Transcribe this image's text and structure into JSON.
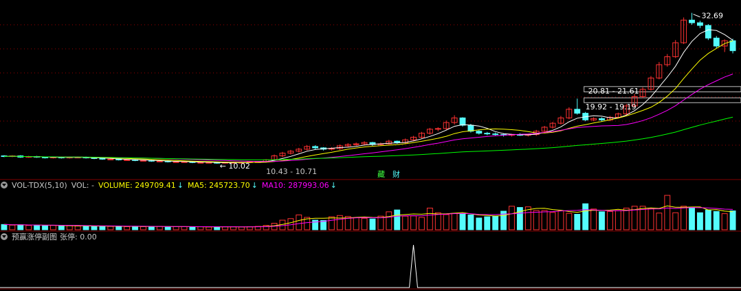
{
  "colors": {
    "up": "#ff3232",
    "down": "#54fcfc",
    "ma5": "#ffffff",
    "ma10": "#ffff00",
    "ma20": "#ff00ff",
    "ma60": "#00ff00",
    "grid": "#a00000",
    "volume_label": "#ffff00",
    "vol_ma5": "#ffff00",
    "vol_ma10": "#ff00ff",
    "separator": "#800000"
  },
  "header": {
    "badges": [
      "藏",
      "财"
    ]
  },
  "price_annotations": {
    "high": "32.69",
    "low": "10.02",
    "range_a": "10.43 - 10.71",
    "range_b": "20.81 - 21.61",
    "range_c": "19.92 - 19.19"
  },
  "volume_panel": {
    "indicator": "VOL-TDX(5,10)",
    "vol": "VOL: -",
    "volume": "VOLUME: 249709.41",
    "ma5": "MA5: 245723.70",
    "ma10": "MA10: 287993.06"
  },
  "signal_panel": {
    "name": "预赢涨停副图",
    "value": "张停: 0.00"
  },
  "chart_data": {
    "type": "candlestick",
    "x": [
      "1",
      "2",
      "3",
      "4",
      "5",
      "6",
      "7",
      "8",
      "9",
      "10",
      "11",
      "12",
      "13",
      "14",
      "15",
      "16",
      "17",
      "18",
      "19",
      "20",
      "21",
      "22",
      "23",
      "24",
      "25",
      "26",
      "27",
      "28",
      "29",
      "30",
      "31",
      "32",
      "33",
      "34",
      "35",
      "36",
      "37",
      "38",
      "39",
      "40",
      "41",
      "42",
      "43",
      "44",
      "45",
      "46",
      "47",
      "48",
      "49",
      "50",
      "51",
      "52",
      "53",
      "54",
      "55",
      "56",
      "57",
      "58",
      "59",
      "60",
      "61",
      "62",
      "63",
      "64",
      "65",
      "66",
      "67",
      "68",
      "69",
      "70",
      "71",
      "72",
      "73",
      "74",
      "75",
      "76",
      "77",
      "78",
      "79",
      "80",
      "81",
      "82",
      "83",
      "84",
      "85",
      "86",
      "87",
      "88",
      "89",
      "90"
    ],
    "open": [
      11.2,
      11.1,
      11.2,
      11.0,
      11.1,
      11.0,
      10.9,
      11.0,
      10.9,
      11.0,
      11.0,
      10.9,
      10.8,
      10.7,
      10.7,
      10.6,
      10.6,
      10.5,
      10.5,
      10.4,
      10.4,
      10.3,
      10.3,
      10.3,
      10.2,
      10.2,
      10.2,
      10.1,
      10.2,
      10.2,
      10.2,
      10.3,
      10.3,
      10.6,
      11.2,
      11.6,
      11.9,
      12.2,
      12.6,
      12.4,
      12.2,
      12.3,
      12.7,
      12.9,
      13.0,
      13.2,
      12.9,
      13.0,
      13.4,
      13.2,
      13.6,
      14.0,
      14.6,
      15.2,
      15.3,
      16.2,
      16.9,
      15.8,
      14.9,
      14.6,
      14.5,
      14.4,
      14.3,
      14.4,
      14.3,
      14.4,
      14.9,
      15.5,
      16.1,
      16.9,
      18.2,
      17.6,
      16.6,
      16.8,
      16.6,
      17.0,
      17.5,
      18.7,
      20.1,
      21.2,
      22.9,
      24.9,
      26.1,
      28.2,
      31.6,
      31.2,
      30.8,
      28.9,
      27.7,
      28.5
    ],
    "close": [
      11.1,
      11.2,
      11.0,
      11.1,
      11.0,
      10.9,
      11.0,
      10.9,
      11.0,
      11.0,
      10.9,
      10.8,
      10.7,
      10.7,
      10.6,
      10.6,
      10.5,
      10.5,
      10.4,
      10.4,
      10.3,
      10.3,
      10.3,
      10.2,
      10.2,
      10.2,
      10.1,
      10.2,
      10.2,
      10.2,
      10.3,
      10.3,
      10.6,
      11.2,
      11.6,
      11.9,
      12.2,
      12.6,
      12.4,
      12.2,
      12.3,
      12.7,
      12.9,
      13.0,
      13.2,
      12.9,
      13.0,
      13.4,
      13.2,
      13.6,
      14.0,
      14.6,
      15.2,
      15.3,
      16.2,
      16.9,
      15.8,
      14.9,
      14.6,
      14.5,
      14.4,
      14.3,
      14.4,
      14.3,
      14.4,
      14.9,
      15.5,
      16.1,
      16.9,
      18.2,
      17.6,
      16.6,
      16.8,
      16.6,
      17.0,
      17.5,
      18.7,
      20.1,
      21.2,
      22.9,
      24.9,
      26.1,
      28.2,
      31.6,
      31.2,
      30.8,
      28.9,
      27.7,
      28.5,
      27.0
    ],
    "high": [
      11.3,
      11.3,
      11.3,
      11.2,
      11.2,
      11.1,
      11.1,
      11.1,
      11.1,
      11.1,
      11.1,
      11.0,
      10.9,
      10.8,
      10.8,
      10.7,
      10.7,
      10.6,
      10.6,
      10.5,
      10.5,
      10.4,
      10.4,
      10.4,
      10.3,
      10.3,
      10.3,
      10.3,
      10.3,
      10.3,
      10.4,
      10.4,
      10.7,
      11.4,
      11.8,
      12.1,
      12.4,
      12.8,
      12.8,
      12.5,
      12.5,
      12.9,
      13.1,
      13.2,
      13.4,
      13.3,
      13.2,
      13.6,
      13.5,
      13.8,
      14.2,
      14.8,
      15.4,
      15.5,
      16.5,
      17.3,
      17.0,
      16.0,
      15.1,
      14.8,
      14.7,
      14.6,
      14.5,
      14.6,
      14.5,
      15.1,
      15.7,
      16.3,
      17.2,
      18.5,
      19.8,
      17.8,
      17.0,
      17.0,
      17.2,
      17.7,
      19.0,
      20.5,
      21.5,
      23.2,
      25.3,
      26.5,
      28.6,
      32.0,
      32.69,
      31.5,
      31.0,
      29.2,
      28.7,
      28.8
    ],
    "low": [
      11.0,
      11.0,
      10.9,
      10.9,
      10.9,
      10.8,
      10.8,
      10.8,
      10.8,
      10.9,
      10.8,
      10.7,
      10.6,
      10.6,
      10.5,
      10.5,
      10.4,
      10.4,
      10.3,
      10.3,
      10.2,
      10.2,
      10.2,
      10.1,
      10.1,
      10.1,
      10.02,
      10.05,
      10.1,
      10.1,
      10.1,
      10.2,
      10.2,
      10.5,
      11.0,
      11.4,
      11.7,
      12.0,
      12.2,
      12.0,
      12.0,
      12.1,
      12.5,
      12.7,
      12.8,
      12.7,
      12.7,
      12.9,
      13.0,
      13.0,
      13.4,
      13.8,
      14.4,
      14.9,
      15.1,
      15.9,
      15.6,
      14.7,
      14.4,
      14.3,
      14.2,
      14.1,
      14.1,
      14.2,
      14.1,
      14.2,
      14.7,
      15.3,
      15.9,
      16.7,
      17.4,
      16.4,
      16.4,
      16.4,
      16.4,
      16.8,
      17.3,
      18.5,
      19.9,
      21.0,
      22.7,
      24.6,
      25.9,
      28.0,
      30.9,
      30.4,
      28.6,
      27.4,
      26.8,
      26.6
    ],
    "volume": [
      17,
      15,
      16,
      14,
      15,
      13,
      14,
      12,
      13,
      12,
      12,
      11,
      12,
      11,
      11,
      10,
      11,
      10,
      10,
      11,
      10,
      10,
      10,
      9,
      10,
      9,
      9,
      10,
      10,
      9,
      10,
      11,
      14,
      21,
      31,
      36,
      48,
      40,
      31,
      30,
      42,
      46,
      43,
      39,
      37,
      35,
      44,
      58,
      64,
      44,
      45,
      40,
      70,
      55,
      49,
      53,
      51,
      48,
      38,
      42,
      43,
      60,
      76,
      72,
      74,
      62,
      62,
      56,
      61,
      53,
      50,
      84,
      67,
      58,
      59,
      62,
      70,
      76,
      76,
      68,
      54,
      111,
      55,
      76,
      71,
      55,
      64,
      59,
      52,
      61
    ],
    "limit_up_signal": [
      0,
      0,
      0,
      0,
      0,
      0,
      0,
      0,
      0,
      0,
      0,
      0,
      0,
      0,
      0,
      0,
      0,
      0,
      0,
      0,
      0,
      0,
      0,
      0,
      0,
      0,
      0,
      0,
      0,
      0,
      0,
      0,
      0,
      0,
      0,
      0,
      0,
      0,
      0,
      0,
      0,
      0,
      0,
      0,
      0,
      0,
      0,
      0,
      0,
      0,
      1,
      0,
      0,
      0,
      0,
      0,
      0,
      0,
      0,
      0,
      0,
      0,
      0,
      0,
      0,
      0,
      0,
      0,
      0,
      0,
      0,
      0,
      0,
      0,
      0,
      0,
      0,
      0,
      0,
      0,
      0,
      0,
      0,
      0,
      0,
      0,
      0,
      0,
      0,
      0
    ],
    "price_range": [
      9.6,
      34.0
    ],
    "ma_periods": [
      5,
      10,
      20,
      60
    ],
    "volume_ma_periods": [
      5,
      10
    ]
  }
}
